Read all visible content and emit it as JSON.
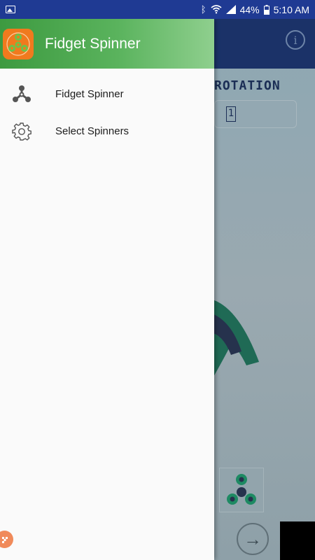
{
  "status_bar": {
    "battery_percent": "44%",
    "time": "5:10 AM",
    "icons": [
      "image-icon",
      "bluetooth-icon",
      "wifi-icon",
      "signal-icon",
      "battery-icon"
    ]
  },
  "drawer": {
    "title": "Fidget Spinner",
    "header_gradient": [
      "#3d9a40",
      "#8fcf8e"
    ],
    "items": [
      {
        "label": "Fidget Spinner",
        "icon": "spinner-icon"
      },
      {
        "label": "Select Spinners",
        "icon": "gear-icon"
      }
    ]
  },
  "background_app": {
    "toolbar_color": "#1b3268",
    "rotation_label": "ROTATION",
    "rotation_value": "1"
  }
}
